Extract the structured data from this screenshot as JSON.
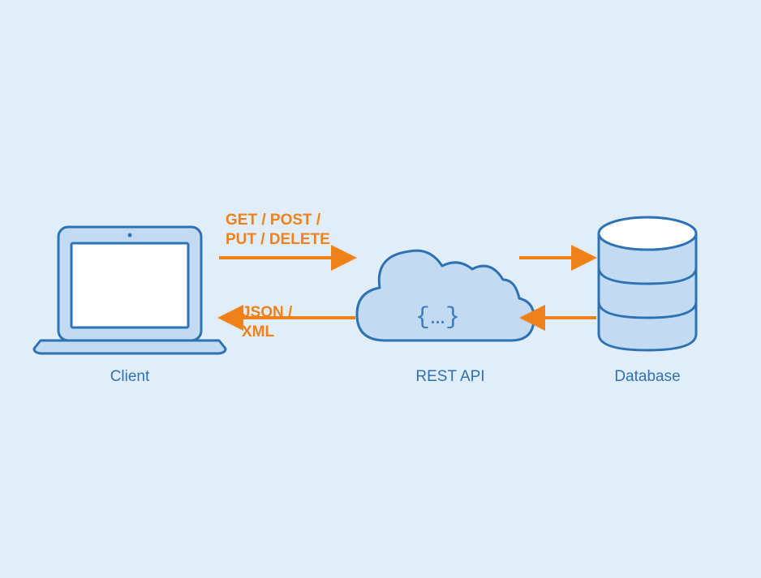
{
  "nodes": {
    "client": {
      "label": "Client"
    },
    "api": {
      "label": "REST API",
      "symbol": "{…}"
    },
    "database": {
      "label": "Database"
    }
  },
  "arrows": {
    "request_methods": "GET / POST /\nPUT / DELETE",
    "response_formats": "JSON /\nXML"
  },
  "colors": {
    "stroke": "#2f72b3",
    "fill_light": "#c2dbf2",
    "fill_white": "#ffffff",
    "arrow": "#ee8119",
    "background": "#e1eefa"
  }
}
